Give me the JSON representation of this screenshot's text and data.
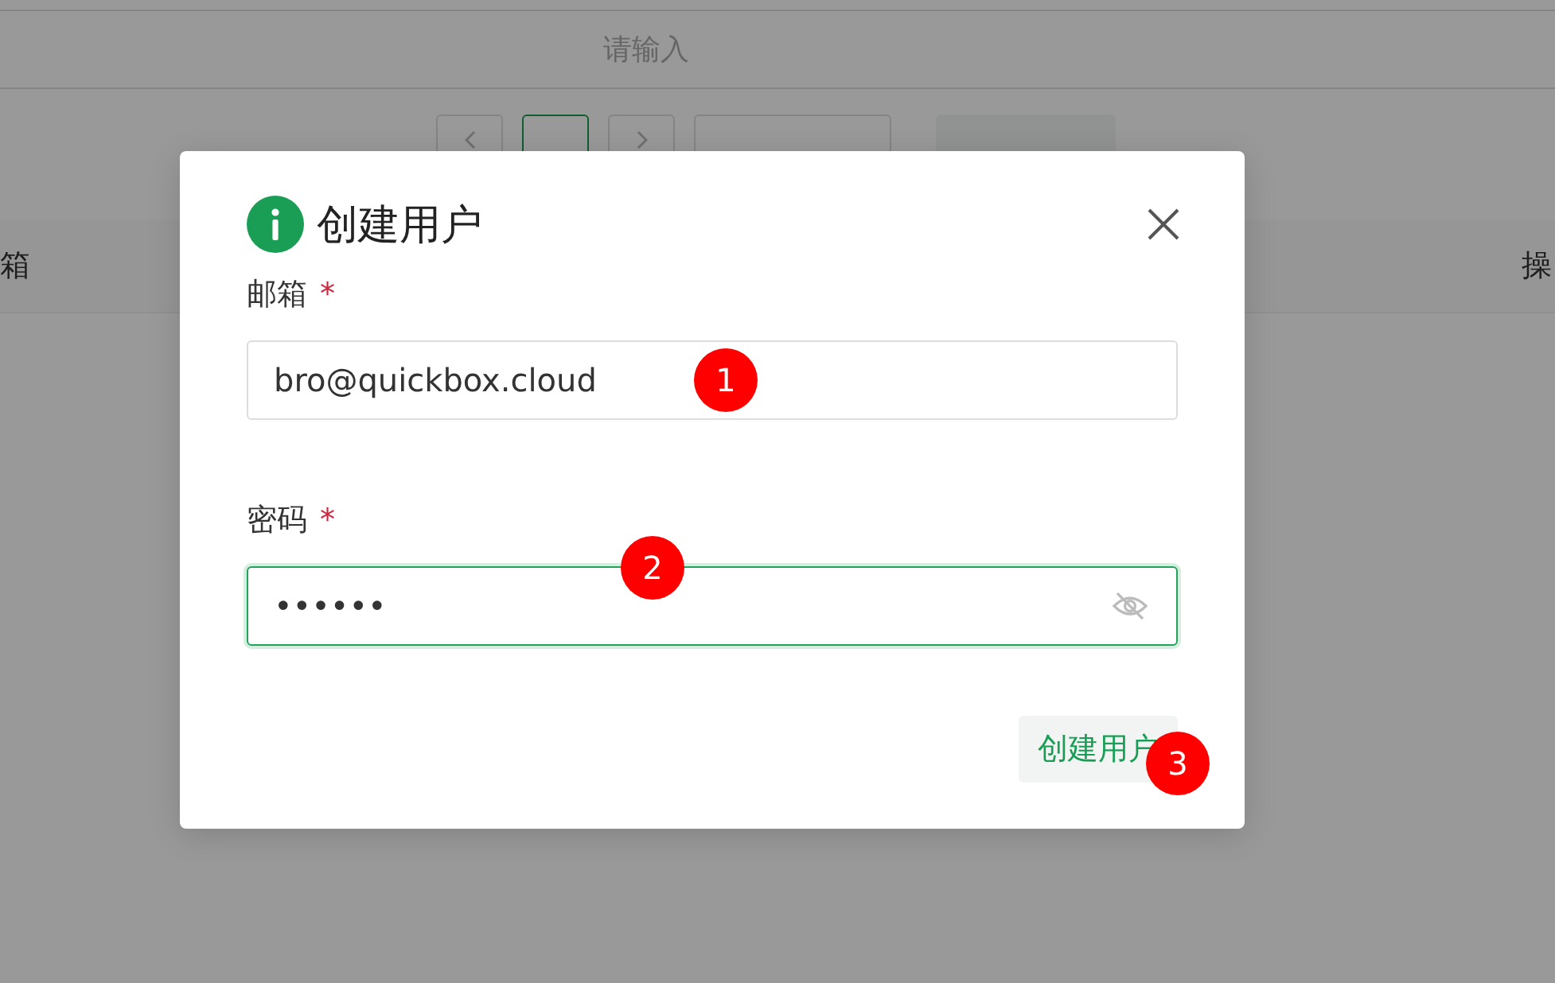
{
  "search": {
    "placeholder": "请输入"
  },
  "pagination": {
    "pages": [
      {
        "selected": true
      }
    ]
  },
  "table": {
    "columns": [
      "箱",
      "操"
    ]
  },
  "dialog": {
    "title": "创建用户",
    "fields": [
      {
        "kind": "text",
        "label": "邮箱",
        "required_mark": "*",
        "value": "bro@quickbox.cloud",
        "focused": false
      },
      {
        "kind": "password",
        "label": "密码",
        "required_mark": "*",
        "value": "••••••",
        "focused": true
      }
    ],
    "submit_button": "创建用户"
  },
  "annotations": [
    {
      "label": "1"
    },
    {
      "label": "2"
    },
    {
      "label": "3"
    }
  ]
}
